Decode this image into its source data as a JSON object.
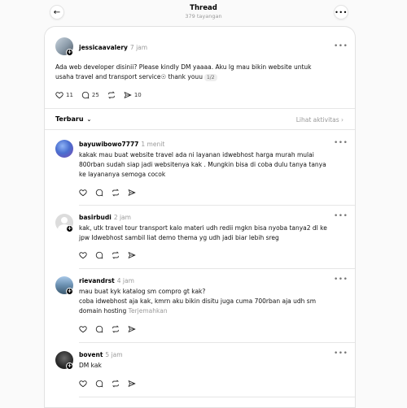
{
  "header": {
    "title": "Thread",
    "subtitle": "379 tayangan"
  },
  "post": {
    "username": "jessicaavalery",
    "time": "7 jam",
    "text_line1": "Ada web developer disinii? Please kindly DM yaaaa. Aku lg mau bikin website untuk",
    "text_line2": "usaha travel and transport service☉ thank youu",
    "pager": "1/2",
    "likes": "11",
    "replies": "25",
    "shares": "10"
  },
  "sort_bar": {
    "sort_label": "Terbaru",
    "activity_label": "Lihat aktivitas"
  },
  "replies": [
    {
      "username": "bayuwibowo7777",
      "time": "1 menit",
      "lines": [
        "kakak mau buat website travel ada ni layanan idwebhost harga murah mulai",
        "800rban sudah siap jadi websitenya kak . Mungkin bisa di coba dulu tanya tanya",
        "ke layananya semoga cocok"
      ]
    },
    {
      "username": "basirbudi",
      "time": "2 jam",
      "lines": [
        "kak, utk travel tour transport kalo materi udh redii mgkn bisa nyoba tanya2 dl ke",
        "jpw Idwebhost sambil liat demo thema yg udh jadi biar lebih sreg"
      ]
    },
    {
      "username": "rievandrst",
      "time": "4 jam",
      "lines": [
        "mau buat kyk katalog sm compro gt kak?",
        "coba idwebhost aja kak, kmrn aku bikin disitu juga cuma 700rban aja udh sm",
        "domain hosting"
      ],
      "translate": "Terjemahkan"
    },
    {
      "username": "bovent",
      "time": "5 jam",
      "lines": [
        "DM kak"
      ]
    }
  ],
  "colors": {
    "accent": "#000000",
    "muted": "#999999",
    "border": "#e2e2e2"
  }
}
